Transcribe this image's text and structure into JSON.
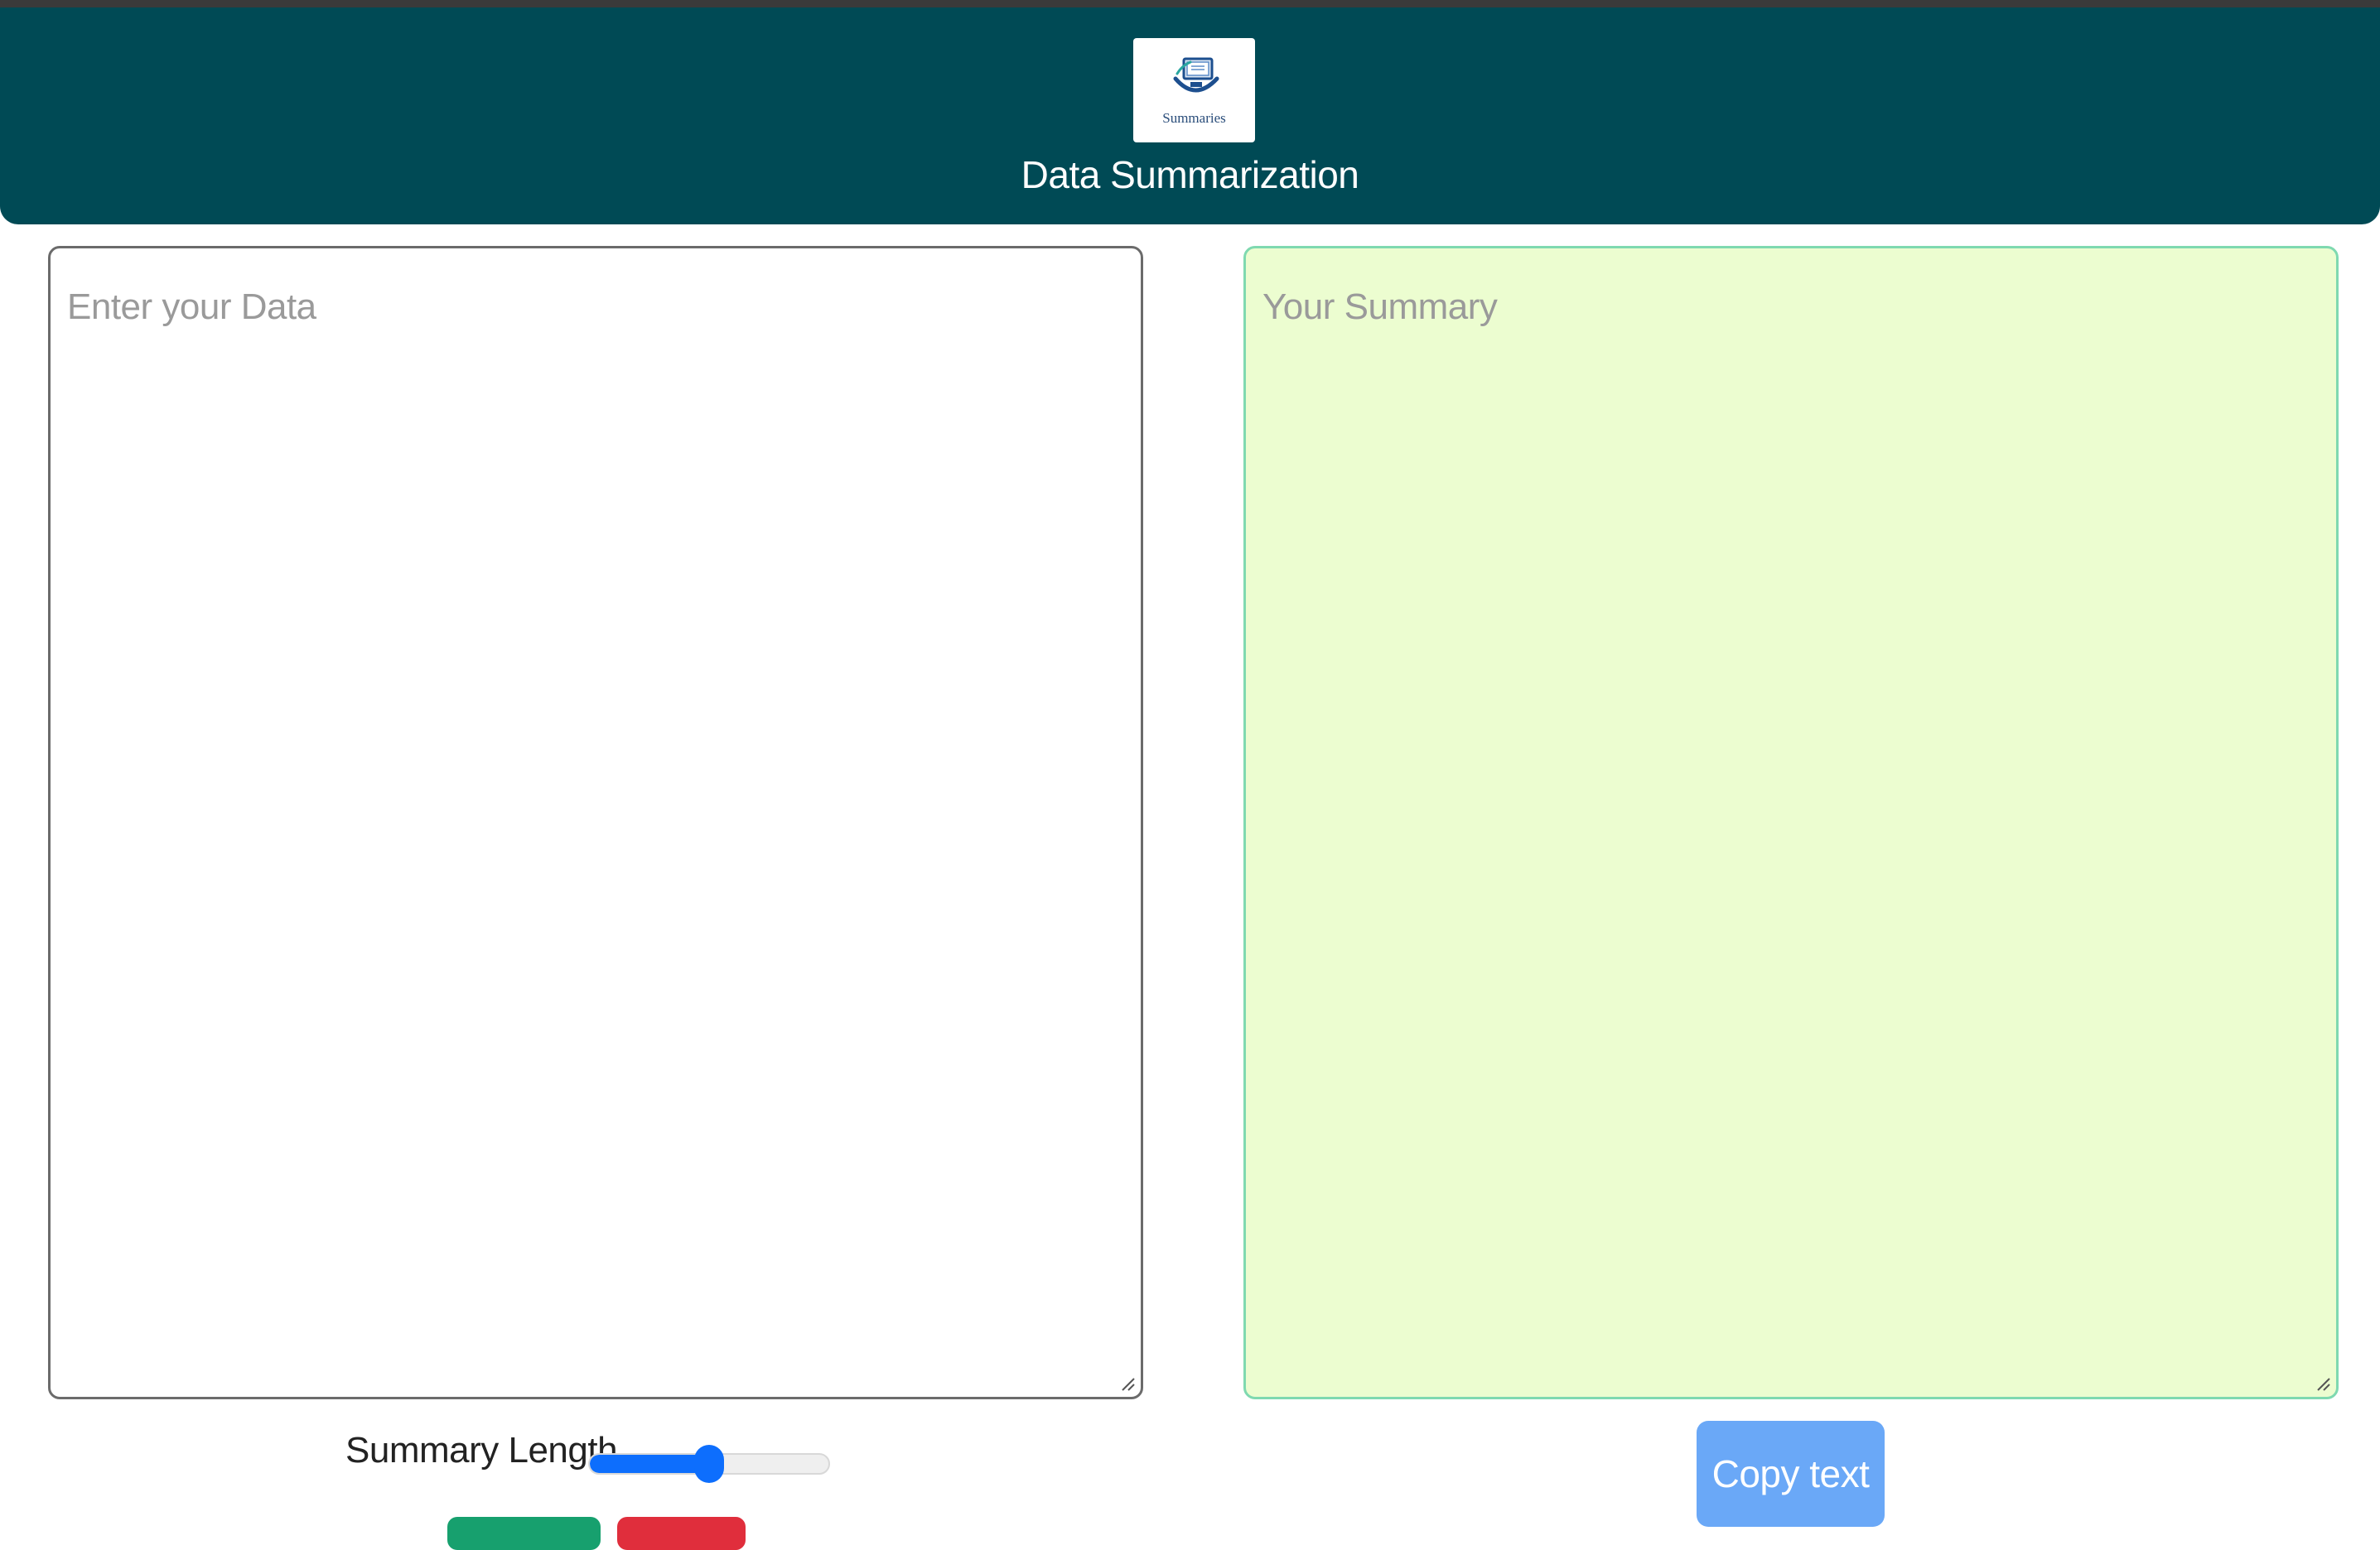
{
  "header": {
    "logo": {
      "icon": "monitor-logo-icon",
      "text": "Summaries"
    },
    "title": "Data Summarization",
    "background_color": "#004a55"
  },
  "input_area": {
    "placeholder": "Enter your Data",
    "value": ""
  },
  "output_area": {
    "placeholder": "Your Summary",
    "value": "",
    "background_color": "#ecfdd0"
  },
  "controls": {
    "summary_length_label": "Summary Length",
    "summary_length_fraction": 0.5,
    "submit_button_color": "#17a06e",
    "clear_button_color": "#e02e3c",
    "copy_button_label": "Copy text",
    "copy_button_color": "#6aa8f7"
  }
}
